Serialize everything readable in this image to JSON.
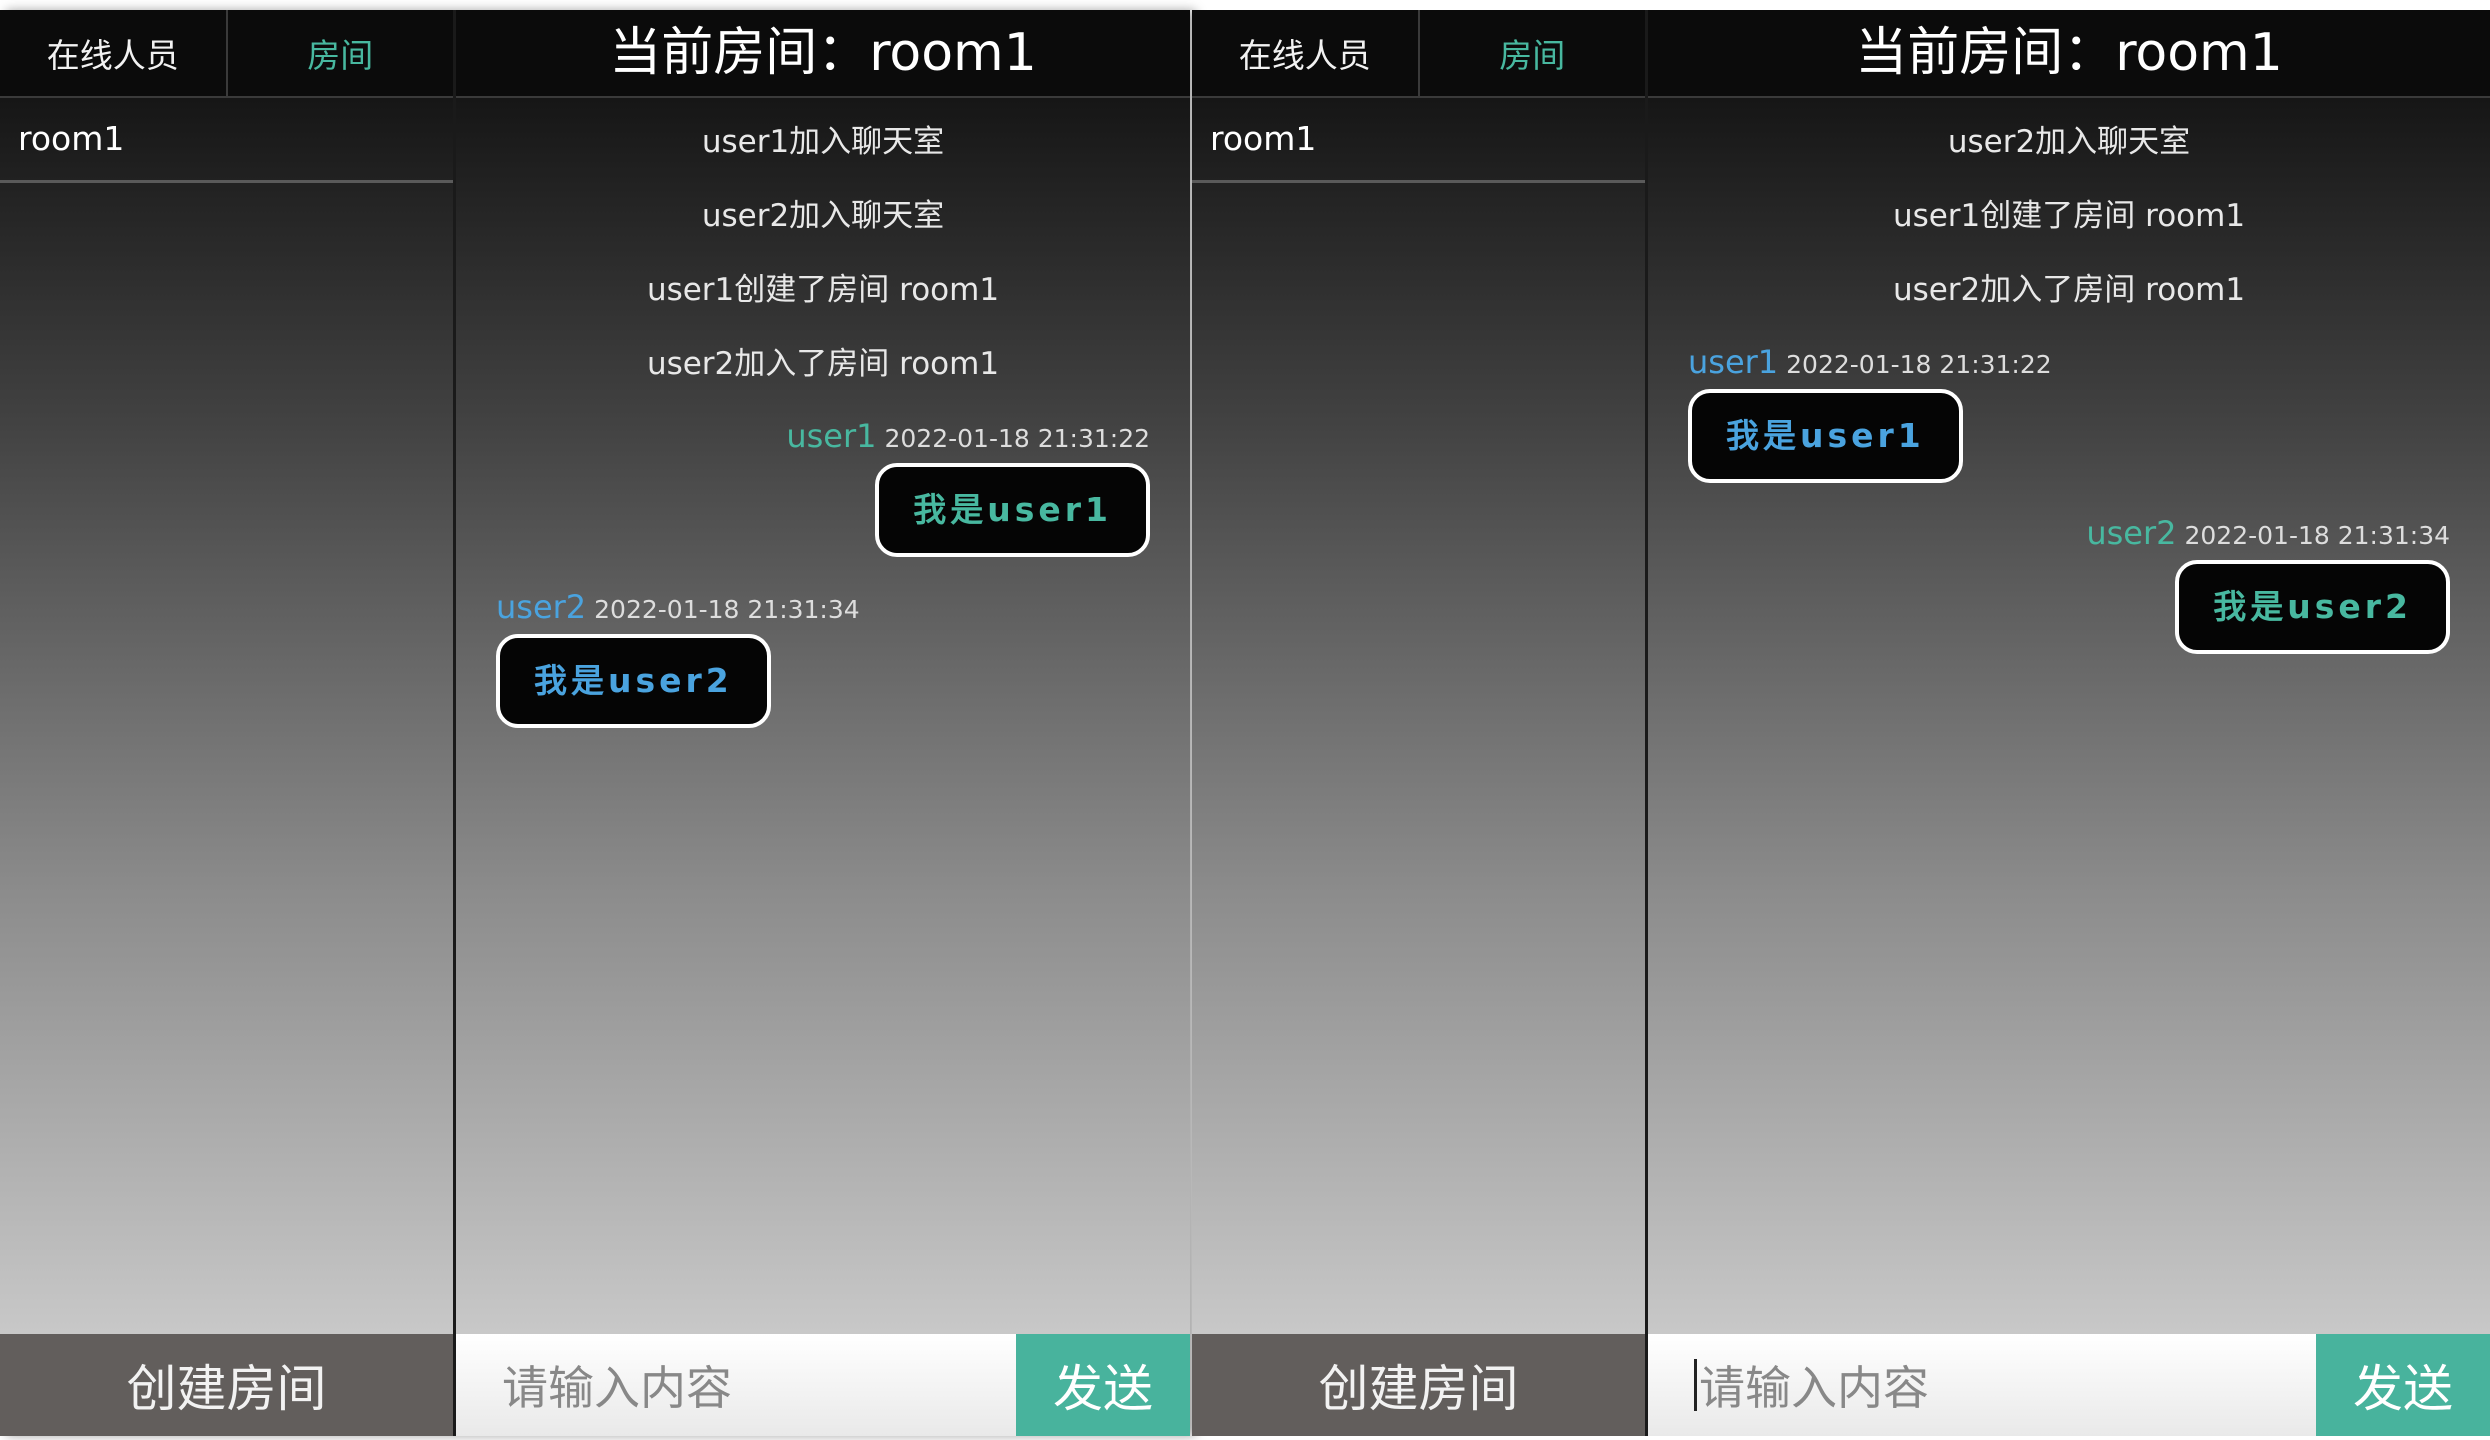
{
  "colors": {
    "user1": "#48b8a0",
    "user2": "#4aa3df"
  },
  "left": {
    "tabs": {
      "online": "在线人员",
      "rooms": "房间"
    },
    "rooms": [
      "room1"
    ],
    "create_button": "创建房间",
    "header": "当前房间：room1",
    "system_messages": [
      "user1加入聊天室",
      "user2加入聊天室",
      "user1创建了房间 room1",
      "user2加入了房间 room1"
    ],
    "messages": [
      {
        "user": "user1",
        "time": "2022-01-18 21:31:22",
        "text": "我是user1"
      },
      {
        "user": "user2",
        "time": "2022-01-18 21:31:34",
        "text": "我是user2"
      }
    ],
    "input_placeholder": "请输入内容",
    "send_button": "发送"
  },
  "right": {
    "tabs": {
      "online": "在线人员",
      "rooms": "房间"
    },
    "rooms": [
      "room1"
    ],
    "create_button": "创建房间",
    "header": "当前房间：room1",
    "system_messages": [
      "user2加入聊天室",
      "user1创建了房间 room1",
      "user2加入了房间 room1"
    ],
    "messages": [
      {
        "user": "user1",
        "time": "2022-01-18 21:31:22",
        "text": "我是user1"
      },
      {
        "user": "user2",
        "time": "2022-01-18 21:31:34",
        "text": "我是user2"
      }
    ],
    "input_placeholder": "请输入内容",
    "send_button": "发送"
  }
}
